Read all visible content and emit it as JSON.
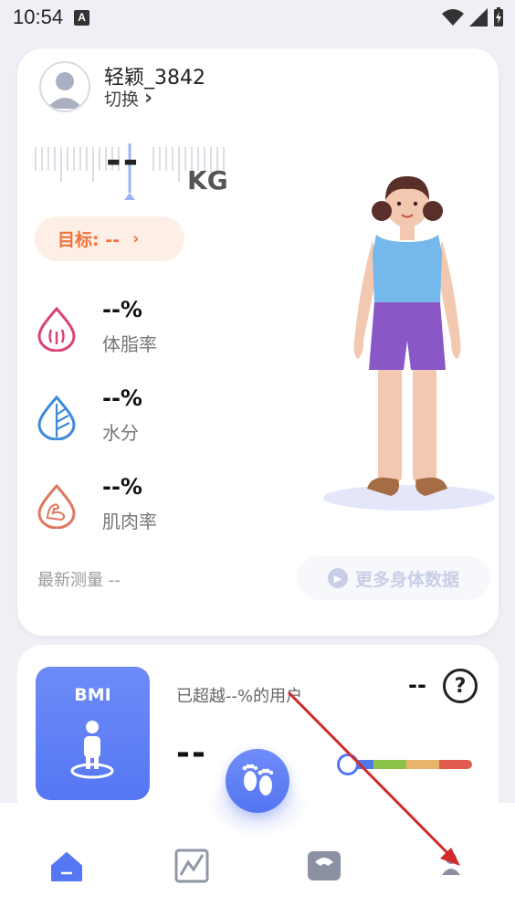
{
  "status": {
    "time": "10:54",
    "notif_letter": "A"
  },
  "profile": {
    "name": "轻颖_3842",
    "switch_label": "切换",
    "switch_chevron": "›"
  },
  "weight": {
    "value": "--",
    "unit": "KG"
  },
  "goal": {
    "label": "目标: --",
    "chevron": "›"
  },
  "metrics": [
    {
      "value": "--%",
      "label": "体脂率",
      "icon": "fat-drop-icon"
    },
    {
      "value": "--%",
      "label": "水分",
      "icon": "water-leaf-icon"
    },
    {
      "value": "--%",
      "label": "肌肉率",
      "icon": "muscle-drop-icon"
    }
  ],
  "latest_measure": "最新测量 --",
  "more_body_data": "更多身体数据",
  "bmi": {
    "tile_title": "BMI",
    "surpass_text": "已超越--%的用户",
    "value": "--",
    "right_value": "--",
    "help_glyph": "?"
  },
  "colors": {
    "accent": "#5677f3",
    "goal_bg": "#fdeee6",
    "goal_text": "#f0743c",
    "scale": [
      "#4f79e8",
      "#8cc24a",
      "#e8b469",
      "#e25d4f"
    ]
  },
  "nav": [
    "home-icon",
    "trend-icon",
    "scale-icon",
    "profile-icon"
  ]
}
